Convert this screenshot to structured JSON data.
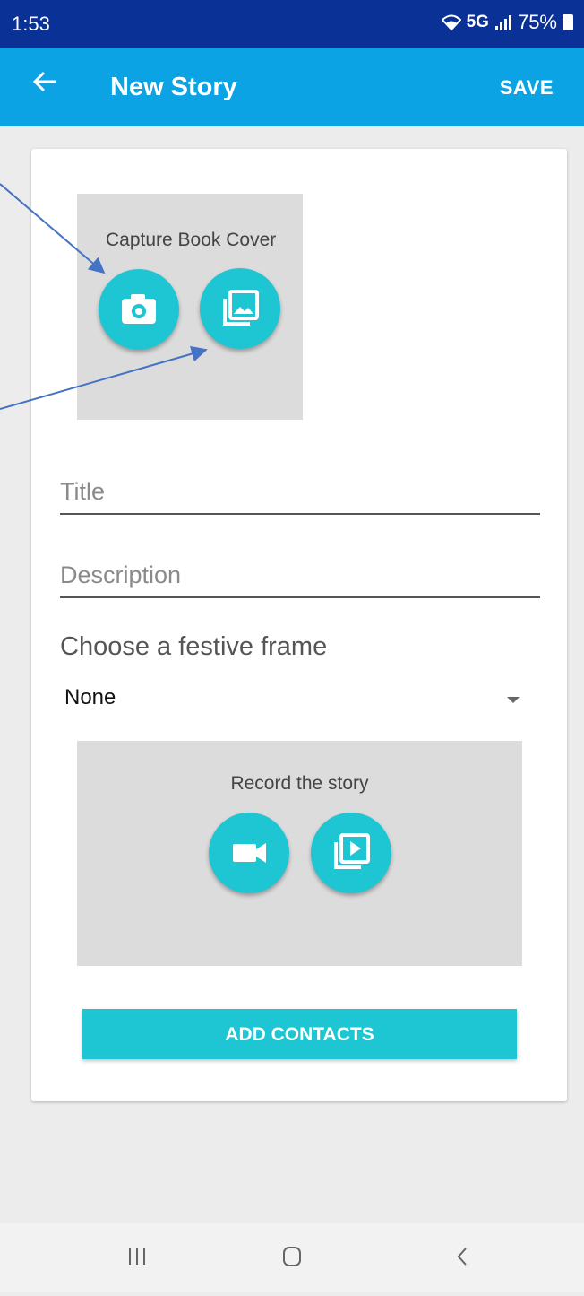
{
  "status_bar": {
    "time": "1:53",
    "network": "5G",
    "battery": "75%"
  },
  "app_bar": {
    "back_icon": "arrow-left-icon",
    "title": "New Story",
    "save_label": "SAVE"
  },
  "cover": {
    "label": "Capture Book Cover",
    "camera_icon": "camera-icon",
    "gallery_icon": "photo-library-icon"
  },
  "form": {
    "title_placeholder": "Title",
    "title_value": "",
    "description_placeholder": "Description",
    "description_value": ""
  },
  "frame": {
    "label": "Choose a festive frame",
    "selected": "None"
  },
  "record": {
    "label": "Record the story",
    "video_icon": "videocam-icon",
    "video_library_icon": "video-library-icon"
  },
  "add_contacts_label": "ADD CONTACTS",
  "nav": {
    "recents_icon": "recents-icon",
    "home_icon": "home-icon",
    "back_icon": "back-chevron-icon"
  },
  "colors": {
    "status_bar": "#0a3196",
    "app_bar": "#0ba3e3",
    "accent": "#1ec6d3",
    "annotation_arrow": "#4472c4"
  }
}
